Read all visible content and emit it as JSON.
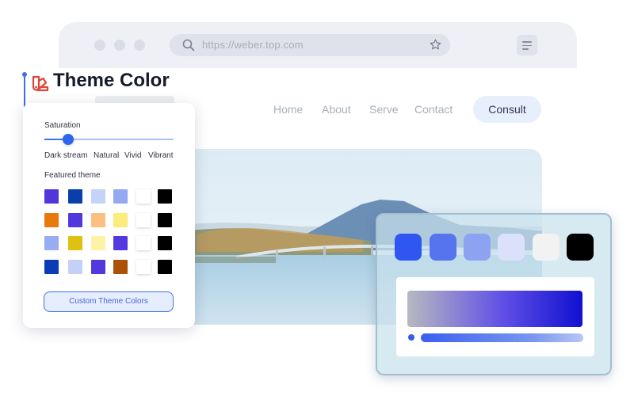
{
  "browser": {
    "url": "https://weber.top.com",
    "nav": [
      "Home",
      "About",
      "Serve",
      "Contact"
    ],
    "cta": "Consult"
  },
  "theme": {
    "title": "Theme Color",
    "saturation_label": "Saturation",
    "saturation_value": 0.18,
    "saturation_options": [
      "Dark stream",
      "Natural",
      "Vivid",
      "Vibrant"
    ],
    "featured_label": "Featured theme",
    "featured_rows": [
      [
        "#5236dc",
        "#0a3ea8",
        "#c5d3f6",
        "#95a9f1",
        "#ffffff",
        "#000000"
      ],
      [
        "#e8790d",
        "#5038dd",
        "#fbbf80",
        "#fbec7b",
        "#ffffff",
        "#000000"
      ],
      [
        "#98acf3",
        "#dfc211",
        "#fdf3a4",
        "#5539e0",
        "#ffffff",
        "#000000"
      ],
      [
        "#0a3cb6",
        "#c4d1f7",
        "#5239dc",
        "#a95208",
        "#ffffff",
        "#000000"
      ]
    ],
    "custom_button": "Custom Theme Colors"
  },
  "picker": {
    "swatches": [
      "#2f56f0",
      "#5674ee",
      "#8ea2f2",
      "#dbe1fa",
      "#f2f2f2",
      "#000000"
    ]
  },
  "colors": {
    "accent": "#3d6ff0",
    "title_icon": "#e0453a"
  }
}
